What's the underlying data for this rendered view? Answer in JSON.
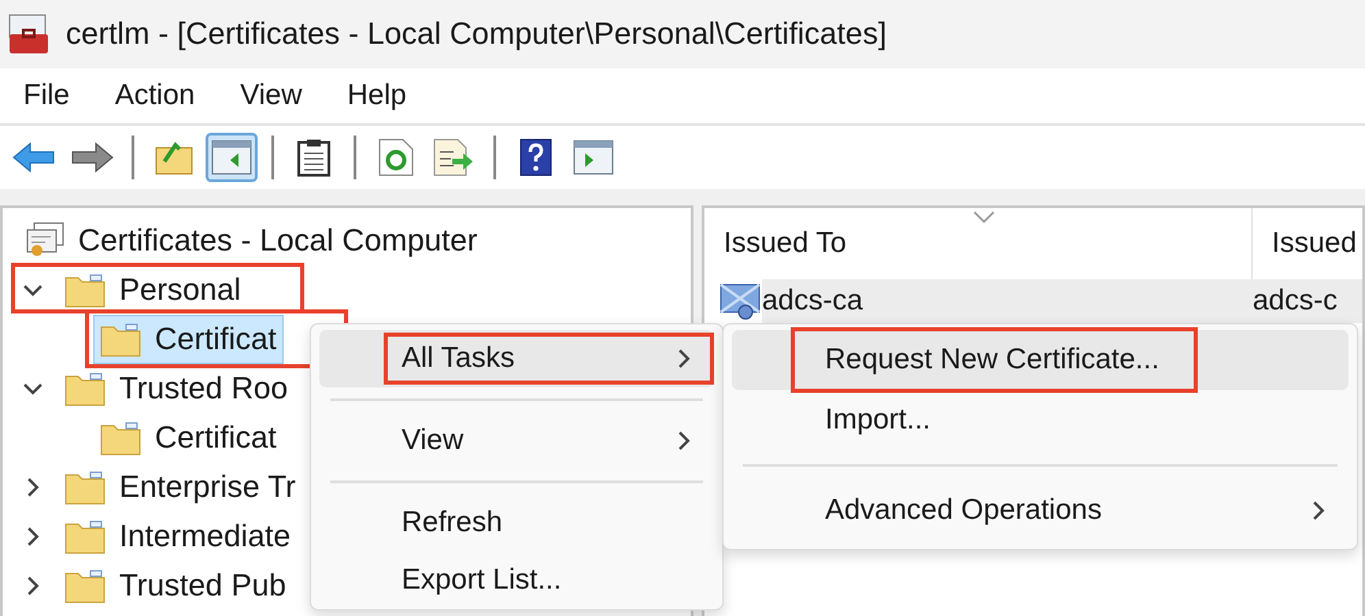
{
  "window": {
    "title": "certlm - [Certificates - Local Computer\\Personal\\Certificates]"
  },
  "menu_bar": [
    "File",
    "Action",
    "View",
    "Help"
  ],
  "toolbar": [
    {
      "kind": "back",
      "pressed": false
    },
    {
      "kind": "forward",
      "pressed": false
    },
    {
      "kind": "separator"
    },
    {
      "kind": "up",
      "pressed": false
    },
    {
      "kind": "tree",
      "pressed": true
    },
    {
      "kind": "separator"
    },
    {
      "kind": "clipboard",
      "pressed": false
    },
    {
      "kind": "separator"
    },
    {
      "kind": "refresh",
      "pressed": false
    },
    {
      "kind": "export",
      "pressed": false
    },
    {
      "kind": "separator"
    },
    {
      "kind": "help",
      "pressed": false
    },
    {
      "kind": "pane",
      "pressed": false
    }
  ],
  "tree": {
    "label": "Certificates - Local Computer",
    "children": [
      {
        "label": "Personal",
        "expanded": true,
        "selected": false,
        "annotated": true,
        "children": [
          {
            "label": "Certificat",
            "selected": true,
            "annotated": true
          }
        ]
      },
      {
        "label": "Trusted Roo",
        "expanded": true,
        "selected": false,
        "annotated": false,
        "children": [
          {
            "label": "Certificat",
            "selected": false,
            "annotated": false
          }
        ]
      },
      {
        "label": "Enterprise Tr",
        "expanded": false,
        "selected": false,
        "annotated": false
      },
      {
        "label": "Intermediate",
        "expanded": false,
        "selected": false,
        "annotated": false
      },
      {
        "label": "Trusted Pub",
        "expanded": false,
        "selected": false,
        "annotated": false
      }
    ]
  },
  "list": {
    "columns": [
      "Issued To",
      "Issued"
    ],
    "rows": [
      {
        "cells": [
          "adcs-ca",
          "adcs-c"
        ],
        "selected": true
      }
    ]
  },
  "context_menu": {
    "items": [
      {
        "kind": "item",
        "label": "All Tasks",
        "submenu": true,
        "highlighted": true,
        "annotated": true
      },
      {
        "kind": "separator"
      },
      {
        "kind": "item",
        "label": "View",
        "submenu": true,
        "highlighted": false,
        "annotated": false
      },
      {
        "kind": "separator"
      },
      {
        "kind": "item",
        "label": "Refresh",
        "submenu": false,
        "highlighted": false,
        "annotated": false
      },
      {
        "kind": "item",
        "label": "Export List...",
        "submenu": false,
        "highlighted": false,
        "annotated": false
      }
    ]
  },
  "submenu": {
    "items": [
      {
        "kind": "item",
        "label": "Request New Certificate...",
        "submenu": false,
        "highlighted": true,
        "annotated": true
      },
      {
        "kind": "item",
        "label": "Import...",
        "submenu": false,
        "highlighted": false,
        "annotated": false
      },
      {
        "kind": "separator"
      },
      {
        "kind": "item",
        "label": "Advanced Operations",
        "submenu": true,
        "highlighted": false,
        "annotated": false
      }
    ]
  }
}
